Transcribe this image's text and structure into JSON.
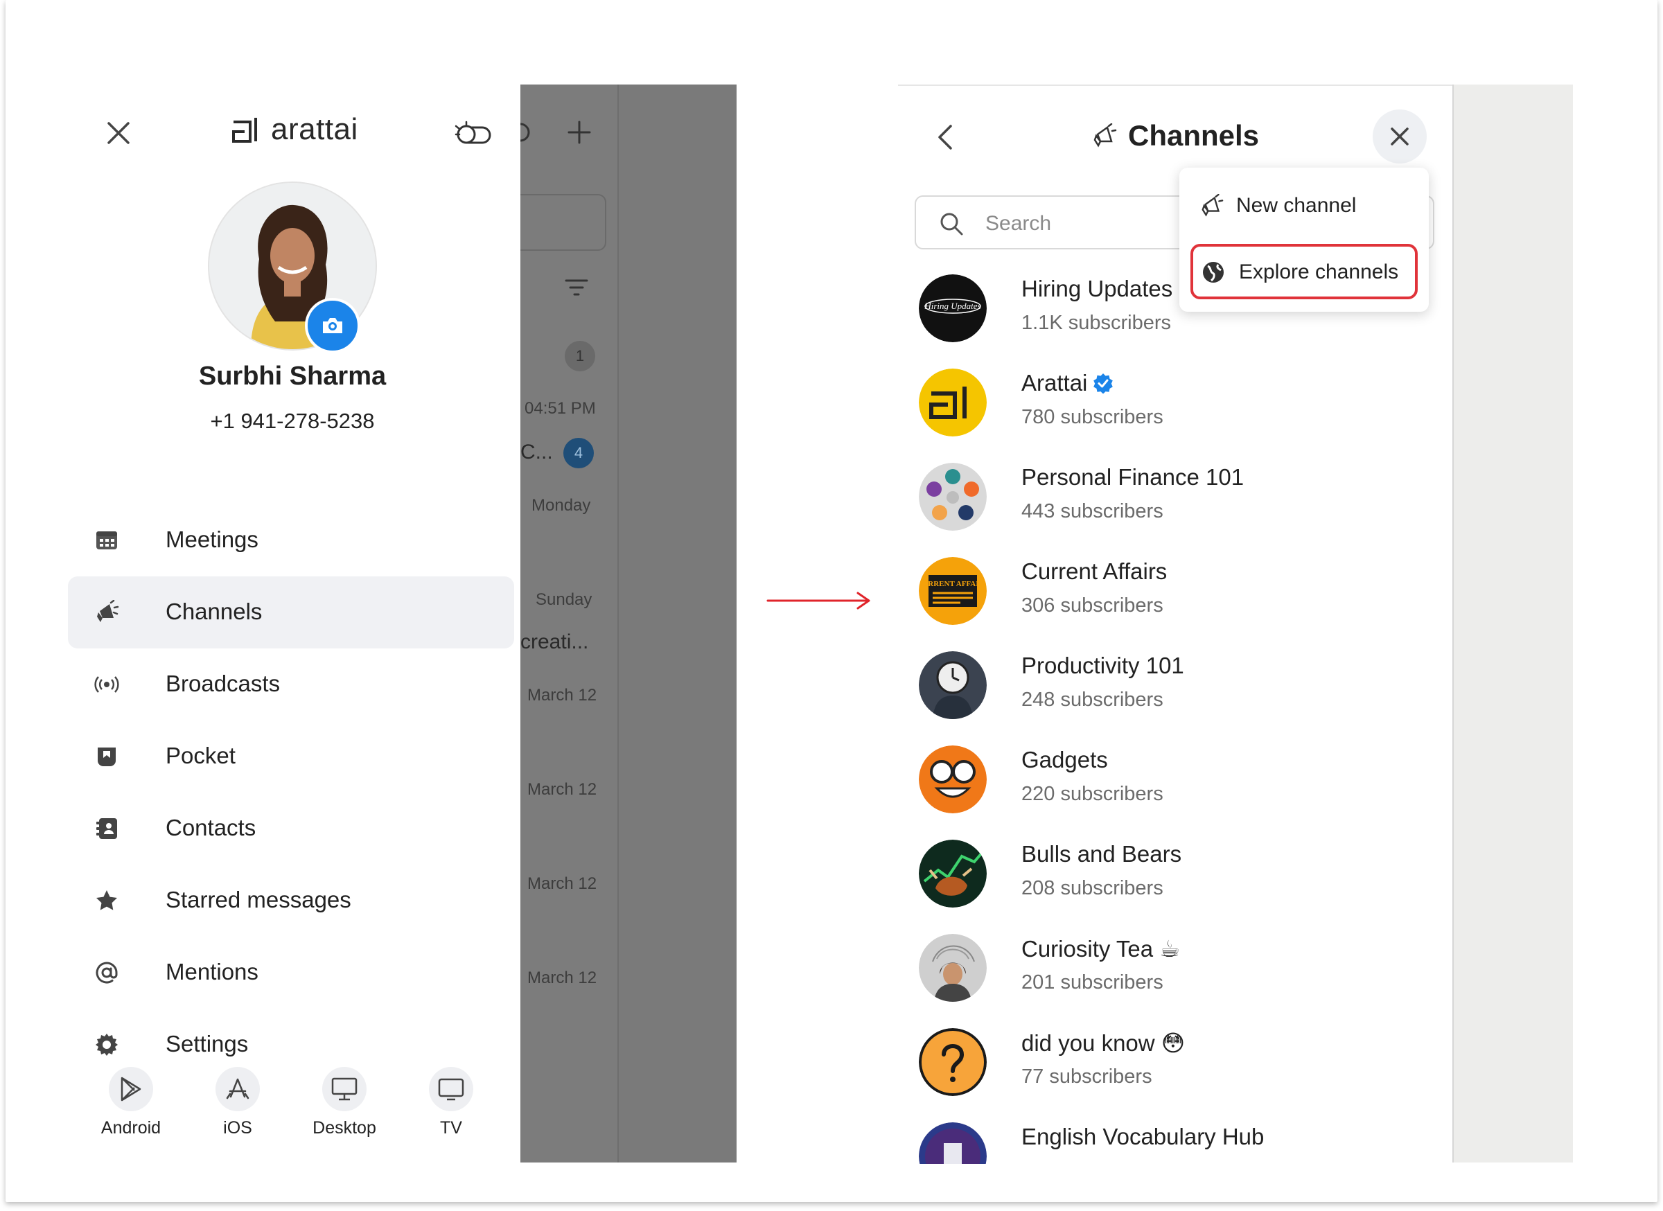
{
  "drawer": {
    "brand": "arattai",
    "user_name": "Surbhi Sharma",
    "user_phone": "+1 941-278-5238",
    "menu": [
      {
        "label": "Meetings",
        "icon": "calendar-icon"
      },
      {
        "label": "Channels",
        "icon": "megaphone-icon",
        "active": true
      },
      {
        "label": "Broadcasts",
        "icon": "broadcast-icon"
      },
      {
        "label": "Pocket",
        "icon": "pocket-icon"
      },
      {
        "label": "Contacts",
        "icon": "contacts-icon"
      },
      {
        "label": "Starred messages",
        "icon": "star-icon"
      },
      {
        "label": "Mentions",
        "icon": "at-icon"
      },
      {
        "label": "Settings",
        "icon": "gear-icon"
      }
    ],
    "platforms": [
      {
        "label": "Android",
        "icon": "play-store-icon"
      },
      {
        "label": "iOS",
        "icon": "app-store-icon"
      },
      {
        "label": "Desktop",
        "icon": "desktop-icon"
      },
      {
        "label": "TV",
        "icon": "tv-icon"
      }
    ]
  },
  "background_list": {
    "unread_count_1": "1",
    "time_1": "04:51 PM",
    "preview_1": "C...",
    "unread_count_2": "4",
    "day_1": "Monday",
    "day_2": "Sunday",
    "preview_2": "creati...",
    "date_1": "March 12",
    "date_2": "March 12",
    "date_3": "March 12",
    "date_4": "March 12"
  },
  "channels_panel": {
    "title": "Channels",
    "search_placeholder": "Search",
    "menu": {
      "new_channel": "New channel",
      "explore_channels": "Explore channels"
    },
    "list": [
      {
        "name": "Hiring Updates",
        "subscribers": "1.1K subscribers"
      },
      {
        "name": "Arattai",
        "subscribers": "780 subscribers",
        "verified": true
      },
      {
        "name": "Personal Finance 101",
        "subscribers": "443 subscribers"
      },
      {
        "name": "Current Affairs",
        "subscribers": "306 subscribers"
      },
      {
        "name": "Productivity 101",
        "subscribers": "248 subscribers"
      },
      {
        "name": "Gadgets",
        "subscribers": "220 subscribers"
      },
      {
        "name": "Bulls and Bears",
        "subscribers": "208 subscribers"
      },
      {
        "name": "Curiosity Tea ☕",
        "subscribers": "201 subscribers"
      },
      {
        "name": "did you know 😳",
        "subscribers": "77 subscribers"
      },
      {
        "name": "English Vocabulary Hub",
        "subscribers": ""
      }
    ]
  },
  "avatar_text": {
    "hiring": "Hiring Updates",
    "current_affairs": "CURRENT AFFAIRS"
  },
  "colors": {
    "accent_blue": "#1b84e9",
    "highlight_red": "#e0333a",
    "arrow_red": "#e0242b"
  }
}
